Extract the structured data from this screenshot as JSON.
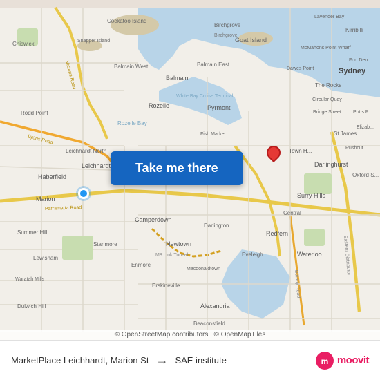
{
  "map": {
    "attribution": "© OpenStreetMap contributors | © OpenMapTiles",
    "button_label": "Take me there",
    "button_color": "#1565C0"
  },
  "bottom_bar": {
    "origin": "MarketPlace Leichhardt, Marion St",
    "arrow": "→",
    "destination": "SAE institute",
    "logo_text": "moovit"
  },
  "landmarks": {
    "goat_island": "Goat Island",
    "sydney": "Sydney",
    "balmain": "Balmain",
    "leichhardt": "Leichhardt",
    "pyrmont": "Pyrmont",
    "newtown": "Newtown",
    "darlinghurst": "Darlinghurst",
    "redfern": "Redfern"
  }
}
